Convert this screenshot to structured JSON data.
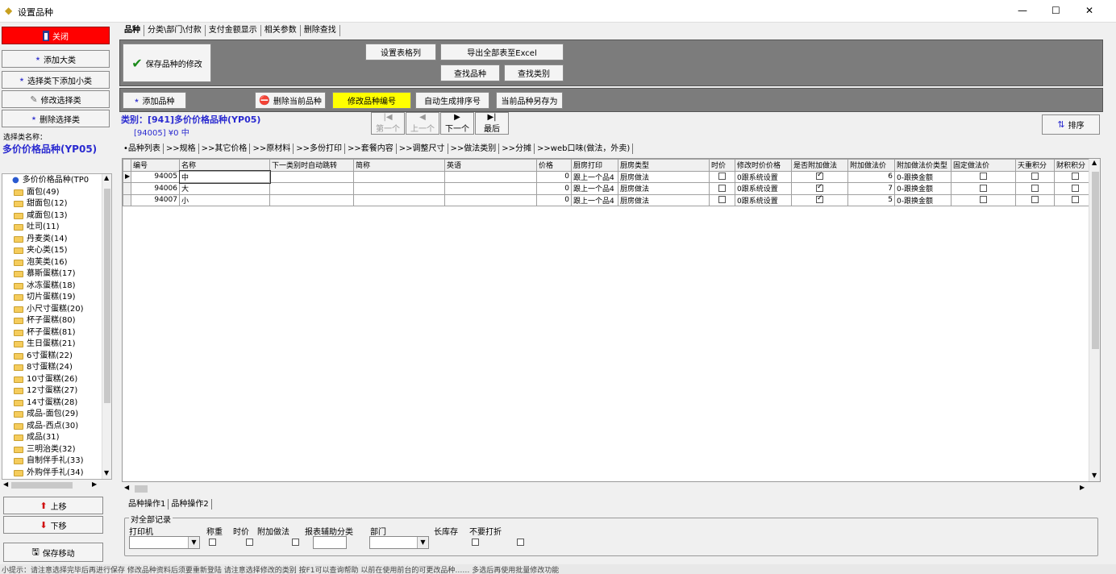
{
  "window": {
    "title": "设置品种",
    "minimize": "—",
    "maximize": "☐",
    "close": "✕"
  },
  "left": {
    "red_button": "关闭",
    "add_major": "添加大类",
    "add_minor": "选择类下添加小类",
    "edit_class": "修改选择类",
    "delete_class": "删除选择类",
    "selected_label": "选择类名称：",
    "selected_name": "多价价格品种(YP05)",
    "tree": [
      {
        "label": "多价价格品种(TP0",
        "root": true
      },
      {
        "label": "面包(49)"
      },
      {
        "label": "甜面包(12)"
      },
      {
        "label": "咸面包(13)"
      },
      {
        "label": "吐司(11)"
      },
      {
        "label": "丹麦类(14)"
      },
      {
        "label": "夹心类(15)"
      },
      {
        "label": "泡芙类(16)"
      },
      {
        "label": "慕斯蛋糕(17)"
      },
      {
        "label": "冰冻蛋糕(18)"
      },
      {
        "label": "切片蛋糕(19)"
      },
      {
        "label": "小尺寸蛋糕(20)"
      },
      {
        "label": "杯子蛋糕(80)"
      },
      {
        "label": "杯子蛋糕(81)"
      },
      {
        "label": "生日蛋糕(21)"
      },
      {
        "label": "6寸蛋糕(22)"
      },
      {
        "label": "8寸蛋糕(24)"
      },
      {
        "label": "10寸蛋糕(26)"
      },
      {
        "label": "12寸蛋糕(27)"
      },
      {
        "label": "14寸蛋糕(28)"
      },
      {
        "label": "成品-面包(29)"
      },
      {
        "label": "成品-西点(30)"
      },
      {
        "label": "成品(31)"
      },
      {
        "label": "三明治类(32)"
      },
      {
        "label": "自制伴手礼(33)"
      },
      {
        "label": "外购伴手礼(34)"
      }
    ],
    "move_up": "上移",
    "move_down": "下移",
    "save_move": "保存移动"
  },
  "top_tabs": [
    "品种",
    "分类\\部门\\付款",
    "支付金额显示",
    "相关参数",
    "删除查找"
  ],
  "toolbar": {
    "save_changes": "保存品种的修改",
    "set_table_format": "设置表格列",
    "export_excel": "导出全部表至Excel",
    "find_item": "查找品种",
    "find_class": "查找类别",
    "add_item": "添加品种",
    "delete_item": "删除当前品种",
    "sort_code": "修改品种编号",
    "auto_sort": "自动生成排序号",
    "save_as": "当前品种另存为"
  },
  "category": {
    "title": "类别：[941]多价价格品种(YP05)",
    "info": "[94005]  ¥0  中"
  },
  "nav": {
    "first": "第一个",
    "prev": "上一个",
    "next": "下一个",
    "last": "最后",
    "sort": "排序"
  },
  "sub_tabs": [
    "•品种列表",
    ">>规格",
    ">>其它价格",
    ">>原材料",
    ">>多份打印",
    ">>套餐内容",
    ">>调整尺寸",
    ">>做法类别",
    ">>分摊",
    ">>web口味(做法，外卖)"
  ],
  "grid": {
    "columns": [
      "编号",
      "名称",
      "下一类别时自动跳转",
      "简称",
      "英语",
      "价格",
      "厨房打印",
      "厨房类型",
      "时价",
      "修改时价价格",
      "是否附加做法",
      "附加做法价",
      "附加做法价类型",
      "固定做法价",
      "天重积分",
      "财积积分"
    ],
    "rows": [
      [
        "94005",
        "中",
        "",
        "",
        "",
        "0",
        "跟上一个品4",
        "厨房做法",
        "",
        "0跟系统设置",
        "on",
        "6",
        "0-跟换金额",
        "",
        "",
        ""
      ],
      [
        "94006",
        "大",
        "",
        "",
        "",
        "0",
        "跟上一个品4",
        "厨房做法",
        "",
        "0跟系统设置",
        "on",
        "7",
        "0-跟换金额",
        "",
        "",
        ""
      ],
      [
        "94007",
        "小",
        "",
        "",
        "",
        "0",
        "跟上一个品4",
        "厨房做法",
        "",
        "0跟系统设置",
        "on",
        "5",
        "0-跟换金额",
        "",
        "",
        ""
      ]
    ]
  },
  "bottom_tabs": [
    "品种操作1",
    "品种操作2"
  ],
  "bulk": {
    "group_label": "对全部记录",
    "printer": "打印机",
    "weigh": "称重",
    "time_price": "时价",
    "add_method": "附加做法",
    "report_class": "报表辅助分类",
    "department": "部门",
    "long_stock": "长库存",
    "no_discount": "不要打折"
  },
  "status_text": "小提示：请注意选择完毕后再进行保存   修改品种资料后须要重新登陆   请注意选择修改的类别   按F1可以查询帮助   以前在使用前台的可更改品种……  多选后再使用批量修改功能"
}
